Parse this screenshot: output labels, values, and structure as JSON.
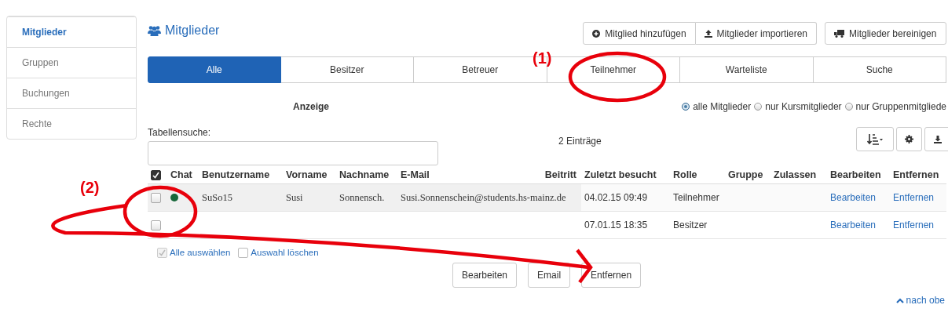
{
  "sidebar": {
    "items": [
      {
        "label": "Mitglieder",
        "selected": true
      },
      {
        "label": "Gruppen",
        "selected": false
      },
      {
        "label": "Buchungen",
        "selected": false
      },
      {
        "label": "Rechte",
        "selected": false
      }
    ]
  },
  "header": {
    "title": "Mitglieder",
    "actions": [
      "Mitglied hinzufügen",
      "Mitglieder importieren",
      "Mitglieder bereinigen"
    ]
  },
  "tabs": [
    {
      "label": "Alle",
      "selected": true
    },
    {
      "label": "Besitzer",
      "selected": false
    },
    {
      "label": "Betreuer",
      "selected": false
    },
    {
      "label": "Teilnehmer",
      "selected": false
    },
    {
      "label": "Warteliste",
      "selected": false
    },
    {
      "label": "Suche",
      "selected": false
    }
  ],
  "display": {
    "label": "Anzeige",
    "options": [
      {
        "label": "alle Mitglieder",
        "selected": true
      },
      {
        "label": "nur Kursmitglieder",
        "selected": false
      },
      {
        "label": "nur Gruppenmitgliede",
        "selected": false
      }
    ]
  },
  "search": {
    "label": "Tabellensuche:"
  },
  "entry_count": "2 Einträge",
  "table": {
    "all_checked": true,
    "columns": [
      "Chat",
      "Benutzername",
      "Vorname",
      "Nachname",
      "E-Mail",
      "Beitritt",
      "Zuletzt besucht",
      "Rolle",
      "Gruppe",
      "Zulassen",
      "Bearbeiten",
      "Entfernen"
    ],
    "rows": [
      {
        "checked": false,
        "highlighted": true,
        "color": "#16673a",
        "username": "SuSo15",
        "first_name": "Susi",
        "last_name": "Sonnensch.",
        "email": "Susi.Sonnenschein@students.hs-mainz.de",
        "last_visit": "04.02.15 09:49",
        "role": "Teilnehmer",
        "edit": "Bearbeiten",
        "remove": "Entfernen"
      },
      {
        "checked": false,
        "highlighted": false,
        "last_visit": "07.01.15 18:35",
        "role": "Besitzer",
        "edit": "Bearbeiten",
        "remove": "Entfernen"
      }
    ]
  },
  "selection": [
    {
      "label": "Alle auswählen",
      "checked": true
    },
    {
      "label": "Auswahl löschen",
      "checked": false
    }
  ],
  "actions": [
    "Bearbeiten",
    "Email",
    "Entfernen"
  ],
  "back_to_top": "nach obe",
  "annotations": [
    "(1)",
    "(2)"
  ]
}
